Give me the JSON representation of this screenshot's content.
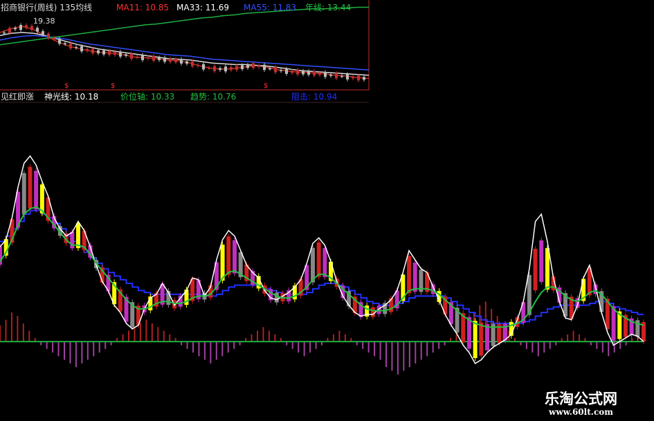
{
  "top_panel": {
    "title": "招商银行(周线)",
    "period_label": "135均线",
    "ma11_label": "MA11:",
    "ma11_value": "10.85",
    "ma33_label": "MA33:",
    "ma33_value": "11.69",
    "ma55_label": "MA55:",
    "ma55_value": "11.83",
    "year_label": "年线:",
    "year_value": "13.44",
    "price_marker": "19.38",
    "signal_marker": "$",
    "colors": {
      "ma11": "#ff3030",
      "ma33": "#ffffff",
      "ma55": "#3050ff",
      "year": "#20c040"
    }
  },
  "indicator_panel": {
    "name": "见红即涨",
    "shenguang_label": "神光线:",
    "shenguang_value": "10.18",
    "price_axis_label": "价位轴:",
    "price_axis_value": "10.33",
    "trend_label": "趋势:",
    "trend_value": "10.76",
    "resistance_label": "阻击:",
    "resistance_value": "10.94",
    "colors": {
      "shenguang": "#ffffff",
      "price_axis": "#20c040",
      "trend": "#20c040",
      "resistance": "#2030ff"
    }
  },
  "watermark": {
    "text": "乐淘公式网",
    "url": "www.60lt.com"
  },
  "chart_data": [
    {
      "type": "line",
      "title": "招商银行(周线)",
      "series": [
        {
          "name": "MA11",
          "values": [
            18.6,
            19.1,
            19.4,
            19.0,
            18.2,
            17.5,
            16.9,
            16.5,
            16.2,
            16.0,
            15.9,
            15.7,
            15.4,
            15.3,
            15.2,
            15.0,
            14.9,
            14.6,
            14.2,
            13.9,
            13.8,
            13.9,
            14.1,
            14.3,
            14.0,
            13.7,
            13.5,
            13.4,
            13.3,
            13.2,
            13.0,
            12.9,
            12.7,
            12.6
          ]
        },
        {
          "name": "MA33",
          "values": [
            18.2,
            18.5,
            18.6,
            18.5,
            18.2,
            17.8,
            17.4,
            17.0,
            16.7,
            16.4,
            16.2,
            16.0,
            15.8,
            15.6,
            15.4,
            15.2,
            15.1,
            15.0,
            14.8,
            14.6,
            14.5,
            14.4,
            14.4,
            14.3,
            14.2,
            14.0,
            13.8,
            13.6,
            13.5,
            13.4,
            13.3,
            13.2,
            13.1,
            13.0
          ]
        },
        {
          "name": "MA55",
          "values": [
            17.6,
            17.9,
            18.1,
            18.2,
            18.1,
            17.9,
            17.7,
            17.4,
            17.1,
            16.9,
            16.7,
            16.5,
            16.3,
            16.1,
            15.9,
            15.7,
            15.6,
            15.5,
            15.3,
            15.1,
            15.0,
            14.9,
            14.8,
            14.7,
            14.6,
            14.5,
            14.4,
            14.3,
            14.2,
            14.1,
            14.0,
            13.9,
            13.8,
            13.7
          ]
        },
        {
          "name": "年线",
          "values": [
            17.0,
            17.2,
            17.4,
            17.6,
            17.8,
            18.0,
            18.2,
            18.4,
            18.6,
            18.8,
            19.0,
            19.2,
            19.4,
            19.6,
            19.7,
            19.9,
            20.1,
            20.3,
            20.5,
            20.6,
            20.8,
            20.9,
            21.1,
            21.2,
            21.3,
            21.4,
            21.5,
            21.6,
            21.7,
            21.7,
            21.8,
            21.8,
            21.9,
            21.9
          ]
        }
      ],
      "ylim": [
        12,
        21.4
      ]
    },
    {
      "type": "line",
      "title": "见红即涨",
      "series": [
        {
          "name": "神光线",
          "values": [
            52,
            56,
            68,
            85,
            98,
            102,
            97,
            88,
            80,
            68,
            62,
            58,
            60,
            66,
            61,
            52,
            42,
            33,
            28,
            20,
            16,
            10,
            7,
            9,
            18,
            24,
            26,
            32,
            27,
            20,
            24,
            28,
            35,
            34,
            25,
            30,
            45,
            56,
            61,
            58,
            50,
            42,
            38,
            35,
            28,
            24,
            23,
            25,
            27,
            30,
            34,
            43,
            54,
            57,
            53,
            44,
            33,
            25,
            20,
            16,
            14,
            15,
            15,
            18,
            20,
            23,
            28,
            38,
            50,
            45,
            40,
            38,
            30,
            23,
            15,
            9,
            4,
            -2,
            -6,
            -12,
            -10,
            -6,
            -3,
            -1,
            1,
            4,
            12,
            22,
            40,
            66,
            70,
            55,
            35,
            22,
            13,
            12,
            20,
            35,
            42,
            30,
            16,
            5,
            -2,
            0,
            2,
            4,
            3,
            0
          ]
        },
        {
          "name": "价位轴",
          "values": [
            44,
            49,
            56,
            64,
            70,
            73,
            74,
            72,
            68,
            64,
            60,
            56,
            53,
            53,
            52,
            48,
            43,
            39,
            35,
            31,
            27,
            23,
            20,
            18,
            18,
            19,
            21,
            22,
            22,
            21,
            21,
            22,
            24,
            25,
            25,
            26,
            30,
            35,
            38,
            39,
            37,
            35,
            33,
            31,
            29,
            27,
            25,
            24,
            24,
            25,
            27,
            30,
            34,
            37,
            37,
            35,
            32,
            29,
            26,
            23,
            20,
            18,
            17,
            17,
            17,
            18,
            20,
            24,
            28,
            29,
            29,
            29,
            28,
            26,
            23,
            20,
            17,
            14,
            12,
            10,
            9,
            8,
            8,
            8,
            8,
            9,
            10,
            12,
            16,
            22,
            27,
            30,
            30,
            28,
            25,
            23,
            22,
            24,
            27,
            28,
            26,
            22,
            18,
            15,
            13,
            11,
            10,
            9
          ]
        },
        {
          "name": "阻击",
          "values": [
            55,
            58,
            62,
            66,
            70,
            72,
            72,
            70,
            68,
            65,
            62,
            58,
            55,
            52,
            49,
            46,
            43,
            40,
            38,
            36,
            34,
            32,
            30,
            28,
            27,
            26,
            26,
            26,
            26,
            26,
            26,
            26,
            26,
            26,
            25,
            25,
            26,
            28,
            30,
            31,
            31,
            31,
            31,
            30,
            29,
            28,
            27,
            26,
            26,
            26,
            26,
            27,
            29,
            31,
            32,
            32,
            31,
            30,
            28,
            26,
            24,
            22,
            21,
            20,
            20,
            20,
            21,
            22,
            24,
            25,
            25,
            25,
            25,
            25,
            24,
            22,
            20,
            18,
            16,
            14,
            12,
            11,
            10,
            10,
            10,
            10,
            10,
            11,
            12,
            14,
            16,
            18,
            19,
            20,
            20,
            20,
            20,
            20,
            21,
            22,
            22,
            21,
            19,
            18,
            17,
            16,
            15,
            15
          ]
        },
        {
          "name": "MACD",
          "values": [
            9,
            12,
            16,
            14,
            10,
            6,
            2,
            -2,
            -4,
            -6,
            -8,
            -10,
            -12,
            -14,
            -12,
            -10,
            -8,
            -6,
            -4,
            -2,
            2,
            4,
            6,
            8,
            10,
            12,
            10,
            8,
            6,
            4,
            2,
            -2,
            -4,
            -6,
            -8,
            -10,
            -12,
            -10,
            -8,
            -6,
            -4,
            -2,
            2,
            4,
            6,
            8,
            6,
            4,
            2,
            -2,
            -4,
            -6,
            -8,
            -6,
            -4,
            -2,
            2,
            4,
            6,
            4,
            2,
            -2,
            -4,
            -6,
            -8,
            -10,
            -14,
            -16,
            -18,
            -16,
            -14,
            -12,
            -10,
            -8,
            -6,
            -4,
            -2,
            2,
            4,
            8,
            12,
            16,
            20,
            22,
            18,
            14,
            10,
            6,
            2,
            -2,
            -4,
            -6,
            -8,
            -6,
            -4,
            -2,
            2,
            4,
            6,
            4,
            2,
            -2,
            -4,
            -6,
            -8,
            -6,
            -4,
            -2,
            2,
            4,
            6
          ]
        }
      ],
      "ylim": [
        -25,
        125
      ]
    }
  ]
}
